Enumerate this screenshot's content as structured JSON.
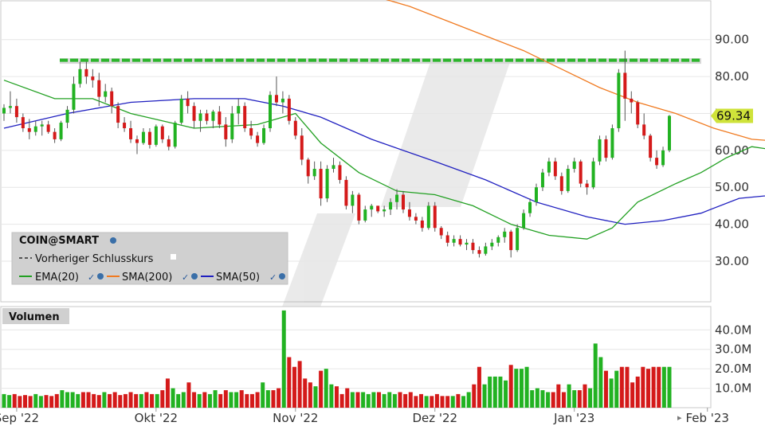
{
  "chart_data": [
    {
      "type": "candlestick",
      "legend": {
        "symbol": "COIN@SMART",
        "items": [
          {
            "name": "Vorheriger Schlusskurs",
            "color": "#555555",
            "style": "dashed"
          },
          {
            "name": "EMA(20)",
            "color": "#22a022",
            "style": "solid"
          },
          {
            "name": "SMA(200)",
            "color": "#f07a20",
            "style": "solid"
          },
          {
            "name": "SMA(50)",
            "color": "#2020c0",
            "style": "solid"
          }
        ]
      },
      "y_ticks": [
        "90.00",
        "80.00",
        "70.00",
        "60.00",
        "50.00",
        "40.00",
        "30.00"
      ],
      "ylim": [
        19.0,
        100.5
      ],
      "last_value": "69.34",
      "x_tick_labels": [
        {
          "i": 2,
          "label": "Sep '22"
        },
        {
          "i": 24,
          "label": "Okt '22"
        },
        {
          "i": 46,
          "label": "Nov '22"
        },
        {
          "i": 68,
          "label": "Dez '22"
        },
        {
          "i": 90,
          "label": "Jan '23"
        },
        {
          "i": 111,
          "label": "Feb '23"
        }
      ],
      "horizontal_line": {
        "value": 84.2,
        "color": "#2cb52c"
      },
      "candles": [
        [
          70,
          72.5,
          68,
          71.5
        ],
        [
          71.5,
          76,
          70,
          72
        ],
        [
          72,
          74,
          67.5,
          69
        ],
        [
          69,
          70,
          65,
          66
        ],
        [
          66,
          68.5,
          63,
          65
        ],
        [
          65,
          68,
          64,
          66.5
        ],
        [
          66.5,
          68,
          64,
          67
        ],
        [
          67,
          68,
          64.5,
          65
        ],
        [
          65,
          66,
          62,
          63
        ],
        [
          63,
          68,
          62.5,
          67.5
        ],
        [
          67.5,
          72,
          66,
          71
        ],
        [
          71,
          80,
          70,
          78
        ],
        [
          78,
          84,
          77,
          82
        ],
        [
          82,
          84,
          78,
          80
        ],
        [
          80,
          82,
          77,
          79
        ],
        [
          79,
          81,
          72,
          74.5
        ],
        [
          74.5,
          78,
          73,
          76
        ],
        [
          76,
          77,
          70,
          72
        ],
        [
          72,
          73,
          66,
          67.5
        ],
        [
          67.5,
          69,
          65,
          66
        ],
        [
          66,
          68,
          62,
          63
        ],
        [
          63,
          64,
          59,
          62
        ],
        [
          62,
          66,
          61.5,
          65
        ],
        [
          65,
          66,
          60.5,
          61.5
        ],
        [
          61.5,
          67,
          61,
          66.5
        ],
        [
          66.5,
          67,
          62,
          63
        ],
        [
          63,
          64,
          60,
          61
        ],
        [
          61,
          68,
          60.5,
          67.5
        ],
        [
          67.5,
          75,
          67,
          74
        ],
        [
          74,
          76,
          70,
          72
        ],
        [
          72,
          73,
          66,
          68
        ],
        [
          68,
          71,
          65,
          70
        ],
        [
          70,
          71,
          67,
          68
        ],
        [
          68,
          71,
          66,
          70.5
        ],
        [
          70.5,
          72,
          66,
          67
        ],
        [
          67,
          69,
          61,
          63
        ],
        [
          63,
          72,
          62,
          70
        ],
        [
          70,
          74,
          67,
          72
        ],
        [
          72,
          73,
          65,
          66
        ],
        [
          66,
          68,
          63,
          64
        ],
        [
          64,
          65,
          61,
          62
        ],
        [
          62,
          67,
          61.5,
          66
        ],
        [
          66,
          76,
          65,
          75
        ],
        [
          75,
          80,
          72,
          73
        ],
        [
          73,
          76,
          70,
          74
        ],
        [
          74,
          75,
          67,
          68
        ],
        [
          68,
          69,
          63,
          64
        ],
        [
          64,
          66,
          56,
          57.5
        ],
        [
          57.5,
          58,
          51,
          53
        ],
        [
          53,
          57,
          52,
          55
        ],
        [
          55,
          57,
          45,
          47
        ],
        [
          47,
          56,
          46,
          55
        ],
        [
          55,
          58,
          54,
          56
        ],
        [
          56,
          57,
          51,
          52
        ],
        [
          52,
          53,
          44,
          45
        ],
        [
          45,
          49,
          43,
          48
        ],
        [
          48,
          48.5,
          40,
          41
        ],
        [
          41,
          45,
          40.5,
          44
        ],
        [
          44,
          45.5,
          42,
          45
        ],
        [
          45,
          45,
          43,
          43.5
        ],
        [
          43.5,
          45,
          42,
          44
        ],
        [
          44,
          47,
          42.5,
          46
        ],
        [
          46,
          49.5,
          44,
          48
        ],
        [
          48,
          49,
          43,
          44
        ],
        [
          44,
          46,
          41,
          42
        ],
        [
          42,
          43,
          40,
          41
        ],
        [
          41,
          42,
          38,
          39
        ],
        [
          39,
          46,
          38.5,
          45
        ],
        [
          45,
          46,
          38,
          39
        ],
        [
          39,
          39.5,
          36,
          37
        ],
        [
          37,
          38,
          34,
          35
        ],
        [
          35,
          37,
          34,
          36
        ],
        [
          36,
          37,
          34,
          34.5
        ],
        [
          34.5,
          36,
          33,
          35
        ],
        [
          35,
          36,
          32,
          33
        ],
        [
          33,
          34,
          31,
          32
        ],
        [
          32,
          35,
          31.5,
          34
        ],
        [
          34,
          36,
          33,
          35
        ],
        [
          35,
          37,
          34,
          36.5
        ],
        [
          36.5,
          39,
          35,
          38
        ],
        [
          38,
          38.5,
          31,
          33
        ],
        [
          33,
          40,
          32.5,
          39
        ],
        [
          39,
          44,
          38.5,
          43
        ],
        [
          43,
          47,
          42,
          46
        ],
        [
          46,
          51,
          45,
          50
        ],
        [
          50,
          55,
          49,
          54
        ],
        [
          54,
          58,
          53,
          57
        ],
        [
          57,
          58,
          52,
          53
        ],
        [
          53,
          54,
          48,
          49
        ],
        [
          49,
          56,
          48.5,
          55
        ],
        [
          55,
          58,
          54,
          57
        ],
        [
          57,
          57.5,
          50,
          51
        ],
        [
          51,
          52,
          48,
          50
        ],
        [
          50,
          58,
          49.5,
          57
        ],
        [
          57,
          64,
          56,
          63
        ],
        [
          63,
          64,
          57,
          58
        ],
        [
          58,
          67,
          57.5,
          66
        ],
        [
          66,
          82,
          65,
          81
        ],
        [
          81,
          87,
          68,
          74
        ],
        [
          74,
          76,
          70,
          73
        ],
        [
          73,
          73.5,
          66,
          67
        ],
        [
          67,
          70,
          63,
          64
        ],
        [
          64,
          64.5,
          57,
          58
        ],
        [
          58,
          60,
          55,
          56
        ],
        [
          56,
          61,
          55.5,
          60
        ],
        [
          60,
          69.6,
          59.5,
          69.34
        ]
      ],
      "ema20": [
        [
          0,
          79
        ],
        [
          8,
          74
        ],
        [
          14,
          74
        ],
        [
          20,
          70
        ],
        [
          30,
          66
        ],
        [
          40,
          67
        ],
        [
          46,
          70
        ],
        [
          50,
          62
        ],
        [
          56,
          54
        ],
        [
          62,
          49
        ],
        [
          68,
          48
        ],
        [
          74,
          45
        ],
        [
          80,
          40
        ],
        [
          86,
          37
        ],
        [
          92,
          36
        ],
        [
          96,
          39
        ],
        [
          100,
          46
        ],
        [
          106,
          51
        ],
        [
          110,
          54
        ],
        [
          114,
          58
        ],
        [
          118,
          61
        ],
        [
          122,
          60
        ],
        [
          126,
          62
        ]
      ],
      "sma50": [
        [
          0,
          66
        ],
        [
          10,
          70
        ],
        [
          20,
          73
        ],
        [
          30,
          74
        ],
        [
          38,
          74
        ],
        [
          44,
          72
        ],
        [
          50,
          69
        ],
        [
          58,
          63
        ],
        [
          68,
          57
        ],
        [
          76,
          52
        ],
        [
          84,
          46
        ],
        [
          92,
          42
        ],
        [
          98,
          40
        ],
        [
          104,
          41
        ],
        [
          110,
          43
        ],
        [
          116,
          47
        ],
        [
          122,
          48
        ],
        [
          126,
          49
        ]
      ],
      "sma200": [
        [
          60,
          101
        ],
        [
          64,
          99
        ],
        [
          70,
          95
        ],
        [
          76,
          91
        ],
        [
          82,
          87
        ],
        [
          88,
          82
        ],
        [
          94,
          77
        ],
        [
          100,
          73
        ],
        [
          106,
          70
        ],
        [
          112,
          66
        ],
        [
          118,
          63
        ],
        [
          126,
          62
        ]
      ],
      "volume": {
        "title": "Volumen",
        "y_ticks": [
          "40.0M",
          "30.0M",
          "20.0M",
          "10.0M"
        ],
        "ylim": [
          0,
          52
        ],
        "values": [
          7,
          6.5,
          7,
          6,
          6.5,
          6,
          7,
          6,
          6.5,
          6,
          7,
          9,
          8,
          8,
          7,
          8,
          8,
          7,
          6.5,
          8,
          7,
          8,
          6.5,
          7,
          8,
          7,
          7,
          8,
          7,
          7,
          9,
          15,
          10,
          7,
          8,
          13,
          8,
          7,
          8,
          7,
          9,
          7,
          9,
          8,
          8,
          9,
          7,
          7,
          8,
          13,
          9,
          9,
          10,
          50,
          26,
          21,
          24,
          15,
          13,
          11,
          19,
          20,
          12,
          11,
          7,
          10,
          8,
          8,
          8,
          7,
          8,
          8,
          7,
          8,
          7,
          8,
          7,
          8,
          6,
          7,
          6,
          6,
          7,
          6,
          6,
          6,
          7,
          6,
          8,
          12,
          21,
          12,
          16,
          16,
          16,
          14,
          22,
          20,
          20,
          21,
          9,
          10,
          9,
          8,
          8,
          12,
          8,
          12,
          9,
          9,
          12,
          10,
          33,
          26,
          19,
          15,
          19,
          21,
          21,
          13,
          16,
          21,
          20,
          21,
          21,
          21,
          21
        ]
      },
      "x_ticks_bottom": [
        "Sep '22",
        "Okt '22",
        "Nov '22",
        "Dez '22",
        "Jan '23",
        "Feb '23"
      ]
    }
  ]
}
